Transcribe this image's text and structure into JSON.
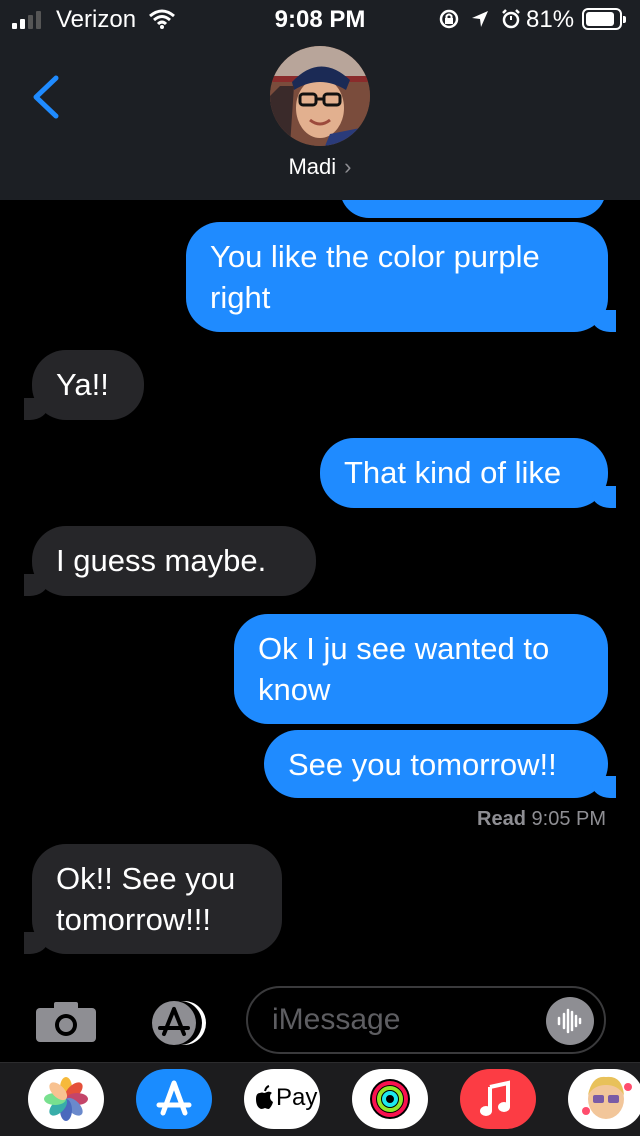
{
  "status_bar": {
    "carrier": "Verizon",
    "time": "9:08 PM",
    "battery": "81%",
    "icons": [
      "signal-icon",
      "wifi-icon",
      "orientation-lock-icon",
      "location-icon",
      "alarm-icon",
      "battery-icon"
    ]
  },
  "header": {
    "contact_name": "Madi",
    "back_icon": "chevron-left-icon"
  },
  "messages": [
    {
      "from": "me",
      "text": "You like the color purple right"
    },
    {
      "from": "them",
      "text": "Ya!!"
    },
    {
      "from": "me",
      "text": "That kind of like"
    },
    {
      "from": "them",
      "text": "I guess maybe."
    },
    {
      "from": "me",
      "text": "Ok I ju see wanted to know"
    },
    {
      "from": "me",
      "text": "See you tomorrow!!"
    },
    {
      "from": "them",
      "text": "Ok!! See you tomorrow!!!"
    }
  ],
  "read_receipt": {
    "label": "Read",
    "time": "9:05 PM"
  },
  "composer": {
    "placeholder": "iMessage"
  },
  "app_drawer": {
    "apps": [
      "photos-app-icon",
      "app-store-icon",
      "apple-pay-icon",
      "activity-icon",
      "music-icon",
      "memoji-icon"
    ],
    "apple_pay_label": "Pay"
  },
  "colors": {
    "sent_bubble": "#1f8bff",
    "received_bubble": "#262629",
    "header_bg": "#1c1f24",
    "accent": "#1f8bff"
  }
}
